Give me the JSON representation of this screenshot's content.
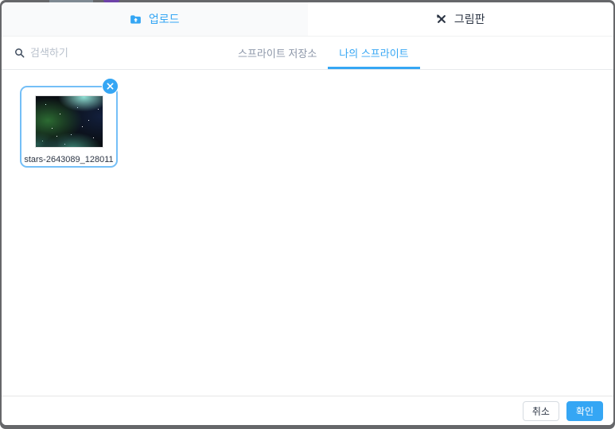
{
  "dialog": {
    "tabs": [
      {
        "label": "업로드",
        "icon": "upload-folder-icon",
        "active": true
      },
      {
        "label": "그림판",
        "icon": "paint-tools-icon",
        "active": false
      }
    ],
    "search": {
      "placeholder": "검색하기",
      "value": "",
      "icon": "search-icon"
    },
    "subtabs": [
      {
        "label": "스프라이트 저장소",
        "active": false
      },
      {
        "label": "나의 스프라이트",
        "active": true
      }
    ],
    "sprites": [
      {
        "name": "stars-2643089_128011",
        "selected": true,
        "thumbnail": "space-nebula-image",
        "remove_icon": "close-icon"
      }
    ],
    "footer": {
      "cancel": "취소",
      "confirm": "확인"
    }
  },
  "colors": {
    "accent": "#35a6f4",
    "selected_card_border": "#74bff7",
    "dark_text": "#2c3544",
    "muted_text": "#8c96a8",
    "placeholder_text": "#b9c1cc"
  }
}
